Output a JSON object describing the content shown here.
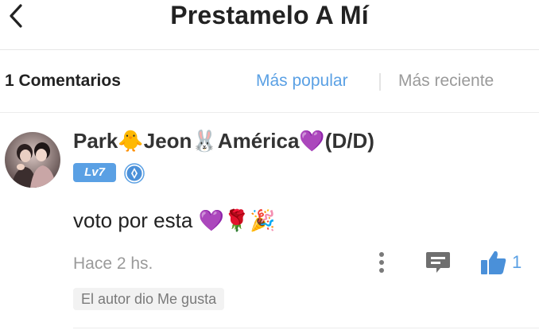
{
  "header": {
    "title": "Prestamelo A Mí",
    "back_icon": "chevron-left-icon"
  },
  "comments_bar": {
    "count_label": "1 Comentarios",
    "sort_popular": "Más popular",
    "sort_recent": "Más reciente",
    "active_sort": "Más popular"
  },
  "comment": {
    "username": "Park🐥Jeon🐰América💜(D/D)",
    "level": "Lv7",
    "text": "voto por esta 💜🌹🎉",
    "timestamp": "Hace 2 hs.",
    "like_count": "1",
    "author_liked": "El autor dio Me gusta"
  },
  "colors": {
    "accent": "#5aa0e4",
    "muted_text": "#9a9a9a",
    "title_text": "#222222"
  }
}
